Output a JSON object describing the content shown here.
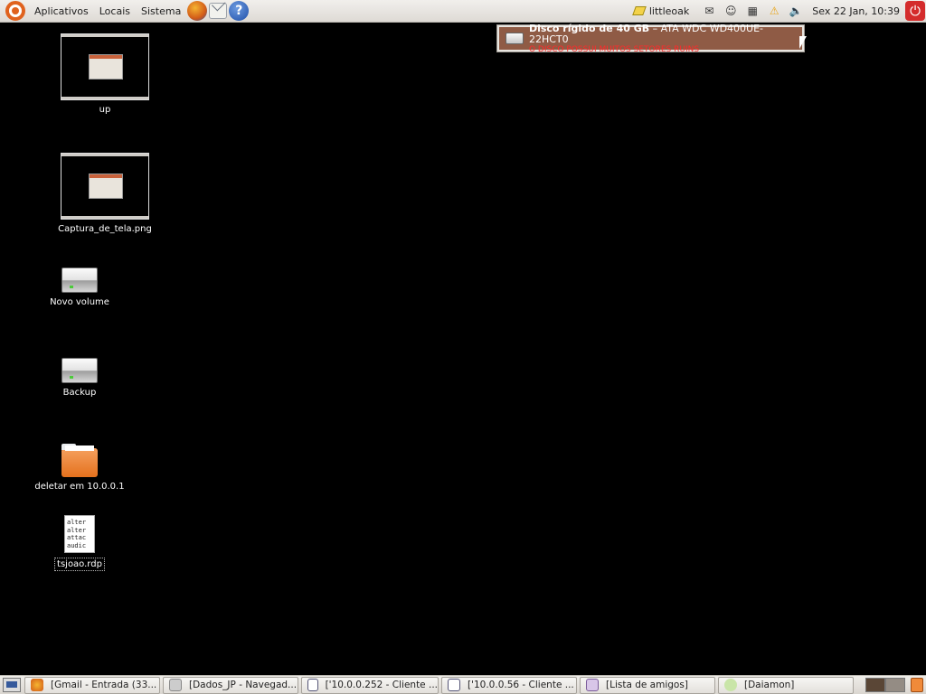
{
  "top_panel": {
    "menus": [
      "Aplicativos",
      "Locais",
      "Sistema"
    ],
    "user": "littleoak",
    "clock": "Sex 22 Jan, 10:39"
  },
  "notification": {
    "title": "Disco rígido de 40 GB",
    "model": " – ATA WDC WD400UE-22HCT0",
    "message": "O DISCO POSSUI MUITOS SETORES RUINS"
  },
  "desktop": {
    "icons": [
      {
        "label": "up"
      },
      {
        "label": "Captura_de_tela.png"
      },
      {
        "label": "Novo volume"
      },
      {
        "label": "Backup"
      },
      {
        "label": "deletar em 10.0.0.1"
      },
      {
        "label": "tsjoao.rdp",
        "preview_lines": [
          "alter",
          "alter",
          "attac",
          "audic"
        ]
      }
    ]
  },
  "taskbar": {
    "tasks": [
      {
        "label": "[Gmail - Entrada (33..."
      },
      {
        "label": "[Dados_JP - Navegad..."
      },
      {
        "label": "['10.0.0.252 - Cliente ..."
      },
      {
        "label": "['10.0.0.56 - Cliente ..."
      },
      {
        "label": "[Lista de amigos]"
      },
      {
        "label": "[Daiamon]"
      }
    ]
  },
  "colors": {
    "accent_orange": "#e0621e",
    "notification_bg": "#8f5b45",
    "warning_red": "#ff2a2a"
  }
}
